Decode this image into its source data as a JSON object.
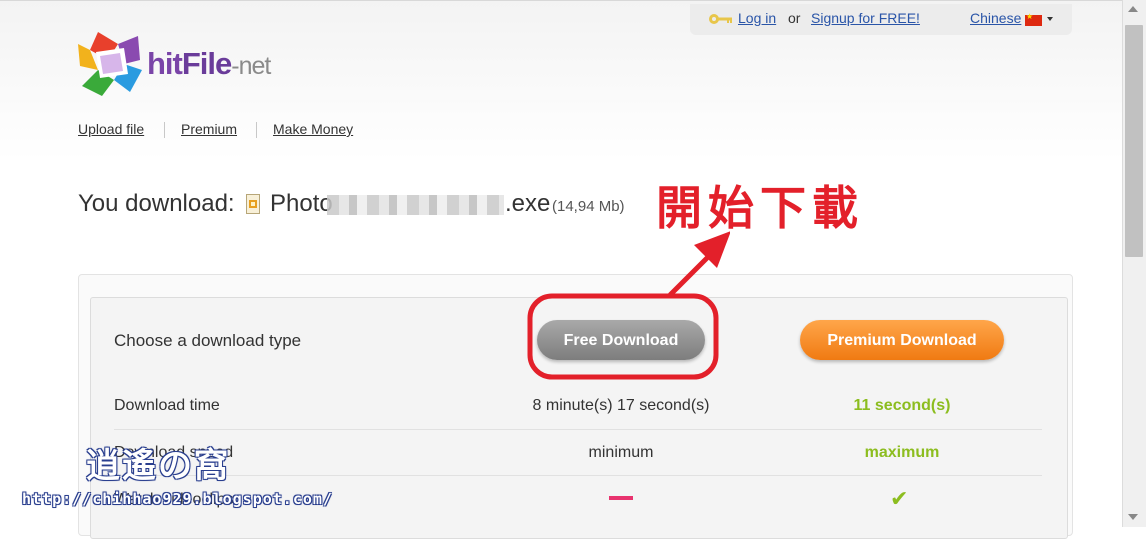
{
  "header": {
    "login_label": "Log in",
    "or_label": "or",
    "signup_label": "Signup for FREE!",
    "language_label": "Chinese"
  },
  "logo": {
    "part1": "hit",
    "part2": "File",
    "part3": "-net"
  },
  "nav": [
    {
      "label": "Upload file"
    },
    {
      "label": "Premium"
    },
    {
      "label": "Make Money"
    }
  ],
  "file": {
    "prefix_label": "You download:",
    "name_start": "Photo",
    "name_end": ".exe",
    "size": "(14,94 Mb)"
  },
  "annotation": {
    "text": "開始下載",
    "color": "#e3202a"
  },
  "download_box": {
    "choose_label": "Choose a download type",
    "free_button": "Free Download",
    "premium_button": "Premium Download",
    "rows": [
      {
        "label": "Download time",
        "free": "8 minute(s) 17 second(s)",
        "premium": "11 second(s)"
      },
      {
        "label": "Download speed",
        "free": "minimum",
        "premium": "maximum"
      },
      {
        "label": "Watch videoclips",
        "free": "",
        "premium": ""
      }
    ]
  },
  "watermark": {
    "title": "逍遙の窩",
    "url": "http://chihhao929.blogspot.com/"
  },
  "colors": {
    "accent_link": "#2a55a8",
    "premium_orange": "#f07a12",
    "green": "#8cbd1f",
    "pink_dash": "#e8336e"
  },
  "icons": [
    "key-icon",
    "china-flag-icon",
    "chevron-down-icon",
    "file-icon",
    "dash-icon",
    "checkmark-icon"
  ]
}
